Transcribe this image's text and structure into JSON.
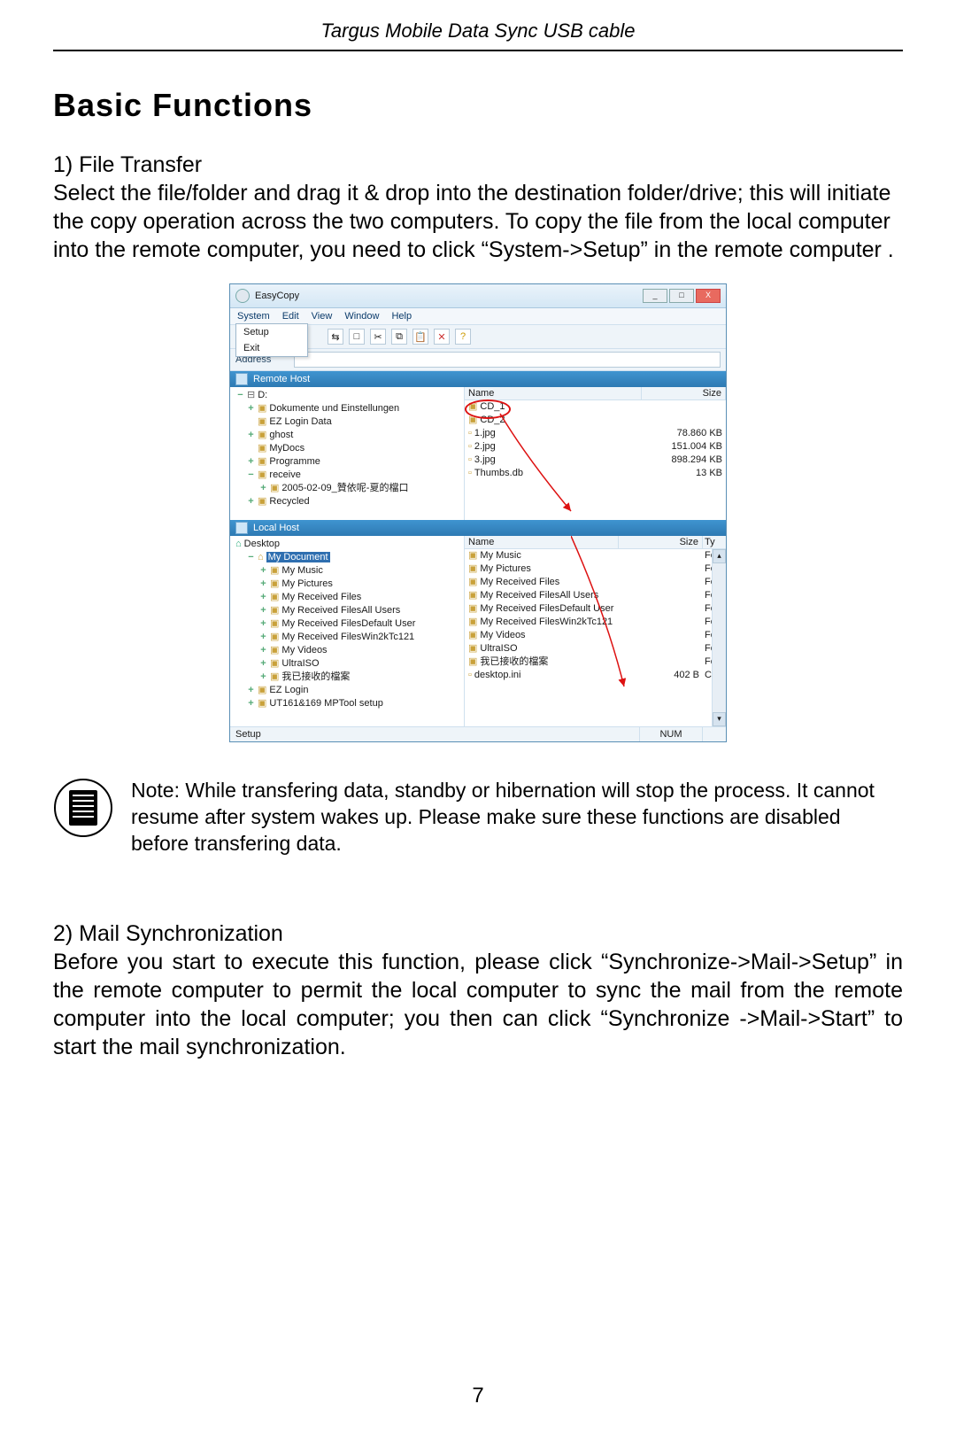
{
  "header": "Targus Mobile Data Sync USB cable",
  "h1": "Basic Functions",
  "section1": {
    "title": "1) File Transfer",
    "body": "Select the file/folder and drag it & drop into the destination folder/drive; this will initiate the copy operation across the two computers. To copy the file from the local computer into the remote computer, you need to click “System->Setup” in the remote computer ."
  },
  "note": "Note: While transfering data, standby or hibernation will stop the process. It cannot resume after system wakes up. Please make sure these functions are disabled before transfering data.",
  "section2": {
    "title": "2) Mail Synchronization",
    "body": "Before you start to execute this function, please click “Synchronize->Mail->Setup” in the remote computer to permit the local computer to sync the mail from the remote computer into the local computer; you then can click “Synchronize ->Mail->Start” to start the mail synchronization."
  },
  "page_num": "7",
  "app": {
    "title": "EasyCopy",
    "menus": [
      "System",
      "Edit",
      "View",
      "Window",
      "Help"
    ],
    "dropdown": [
      "Setup",
      "Exit"
    ],
    "addr_label": "Address",
    "remote": {
      "title": "Remote Host",
      "tree_root": "D:",
      "tree": [
        "Dokumente und Einstellungen",
        "EZ Login Data",
        "ghost",
        "MyDocs",
        "Programme",
        "receive",
        "2005-02-09_贊依呢-夏的檔口",
        "Recycled"
      ],
      "cols": {
        "name": "Name",
        "size": "Size"
      },
      "files": [
        {
          "n": "CD_1",
          "s": "",
          "hl": true
        },
        {
          "n": "CD_2",
          "s": ""
        },
        {
          "n": "1.jpg",
          "s": "78.860 KB"
        },
        {
          "n": "2.jpg",
          "s": "151.004 KB"
        },
        {
          "n": "3.jpg",
          "s": "898.294 KB"
        },
        {
          "n": "Thumbs.db",
          "s": "13 KB"
        }
      ]
    },
    "local": {
      "title": "Local Host",
      "tree_root": "Desktop",
      "tree_sel": "My Document",
      "tree": [
        "My Music",
        "My Pictures",
        "My Received Files",
        "My Received FilesAll Users",
        "My Received FilesDefault User",
        "My Received FilesWin2kTc121",
        "My Videos",
        "UltraISO",
        "我已接收的檔案"
      ],
      "tree_after": [
        "EZ Login",
        "UT161&169 MPTool setup"
      ],
      "cols": {
        "name": "Name",
        "size": "Size",
        "ty": "Ty"
      },
      "files": [
        {
          "n": "My Music",
          "s": "",
          "t": "Fo"
        },
        {
          "n": "My Pictures",
          "s": "",
          "t": "Fo"
        },
        {
          "n": "My Received Files",
          "s": "",
          "t": "Fo"
        },
        {
          "n": "My Received FilesAll Users",
          "s": "",
          "t": "Fo"
        },
        {
          "n": "My Received FilesDefault User",
          "s": "",
          "t": "Fo"
        },
        {
          "n": "My Received FilesWin2kTc121",
          "s": "",
          "t": "Fo"
        },
        {
          "n": "My Videos",
          "s": "",
          "t": "Fo"
        },
        {
          "n": "UltraISO",
          "s": "",
          "t": "Fo"
        },
        {
          "n": "我已接收的檔案",
          "s": "",
          "t": "Fo"
        },
        {
          "n": "desktop.ini",
          "s": "402 B",
          "t": "Co"
        }
      ]
    },
    "status": {
      "left": "Setup",
      "num": "NUM"
    }
  }
}
